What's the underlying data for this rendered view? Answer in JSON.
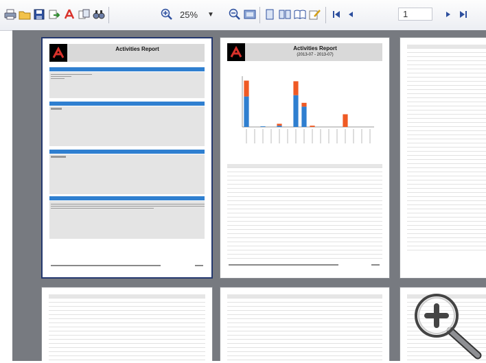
{
  "toolbar": {
    "zoom_value": "25%",
    "page_number": "1",
    "colors": {
      "accent": "#2f7fd0",
      "brand_red": "#d9322b"
    }
  },
  "pages": {
    "p1": {
      "title": "Activities Report",
      "footer_left": "Generated by Active Reports for your Activities Report documentation",
      "footer_right": "Page 1"
    },
    "p2": {
      "title": "Activities Report",
      "subtitle": "(2013-07 - 2013-07)",
      "footer_left": "Generated by Active Reports for your Activities Report documentation",
      "footer_right": "Page 2"
    }
  },
  "chart_data": {
    "type": "bar",
    "series": [
      {
        "name": "",
        "values": [
          48,
          0,
          1,
          0,
          2,
          0,
          50,
          32,
          0,
          0,
          0,
          0,
          0,
          0,
          0,
          0
        ]
      },
      {
        "name": "",
        "values": [
          25,
          0,
          0,
          0,
          3,
          0,
          22,
          6,
          2,
          0,
          0,
          0,
          20,
          0,
          0,
          0
        ]
      }
    ],
    "ylim": [
      0,
      80
    ],
    "colors": [
      "#2f7fd0",
      "#ef5a24"
    ]
  },
  "magnifier": {
    "icon": "zoom-in-icon"
  }
}
